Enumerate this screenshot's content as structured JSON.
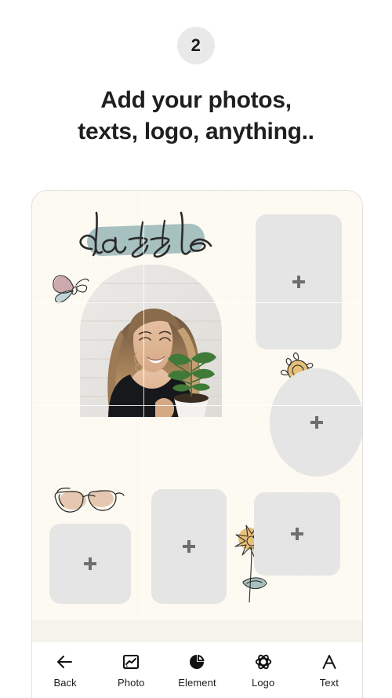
{
  "header": {
    "step_number": "2",
    "headline_line1": "Add your photos,",
    "headline_line2": "texts, logo, anything.."
  },
  "editor": {
    "canvas_background_color": "#fdfaf2",
    "placeholder_color": "#e5e5e5",
    "placeholder_icon": "plus-icon",
    "guides_visible": true,
    "word_art": {
      "text": "dazzle",
      "brush_color": "#a7c0c0",
      "script_color": "#2b2b2b"
    },
    "photo": {
      "alt": "Smiling woman in black top holding a potted plant",
      "mask_shape": "arch"
    },
    "placeholders": [
      {
        "name": "placeholder-top-right",
        "shape": "rect",
        "label": "+"
      },
      {
        "name": "placeholder-mid-right-oval",
        "shape": "oval",
        "label": "+"
      },
      {
        "name": "placeholder-bottom-left",
        "shape": "rect",
        "label": "+"
      },
      {
        "name": "placeholder-bottom-center",
        "shape": "rect",
        "label": "+"
      },
      {
        "name": "placeholder-bottom-right",
        "shape": "rect",
        "label": "+"
      }
    ],
    "stickers": [
      {
        "name": "butterfly-sticker",
        "colors": [
          "#c9a0a6",
          "#b7cdd2"
        ]
      },
      {
        "name": "sun-sticker",
        "colors": [
          "#e8bf78"
        ]
      },
      {
        "name": "sunglasses-sticker",
        "colors": [
          "#e4c5ab"
        ]
      },
      {
        "name": "sunflower-sticker",
        "colors": [
          "#e8bf78",
          "#a7c0c0"
        ]
      }
    ]
  },
  "navbar": {
    "items": [
      {
        "icon": "arrow-left-icon",
        "label": "Back"
      },
      {
        "icon": "image-icon",
        "label": "Photo"
      },
      {
        "icon": "pie-circle-icon",
        "label": "Element"
      },
      {
        "icon": "flower-atom-icon",
        "label": "Logo"
      },
      {
        "icon": "letter-a-icon",
        "label": "Text"
      }
    ]
  }
}
